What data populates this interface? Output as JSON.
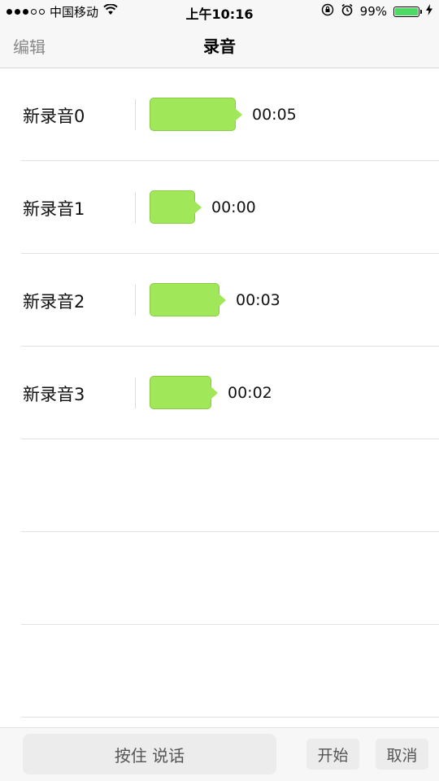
{
  "status_bar": {
    "carrier": "中国移动",
    "time": "上午10:16",
    "battery_percent": "99%",
    "battery_level": 0.99,
    "signal_filled": 3,
    "signal_total": 5,
    "icons": [
      "wifi-icon",
      "orientation-lock-icon",
      "alarm-icon",
      "battery-icon",
      "charging-icon"
    ]
  },
  "nav": {
    "edit_label": "编辑",
    "title": "录音"
  },
  "recordings": [
    {
      "name": "新录音0",
      "duration": "00:05",
      "seconds": 5
    },
    {
      "name": "新录音1",
      "duration": "00:00",
      "seconds": 0
    },
    {
      "name": "新录音2",
      "duration": "00:03",
      "seconds": 3
    },
    {
      "name": "新录音3",
      "duration": "00:02",
      "seconds": 2
    }
  ],
  "empty_rows": 3,
  "bottom_bar": {
    "hold_to_talk_label": "按住 说话",
    "start_label": "开始",
    "cancel_label": "取消"
  },
  "colors": {
    "bubble": "#a0e75a",
    "bubble_border": "#8acb44",
    "battery": "#4cd964"
  }
}
